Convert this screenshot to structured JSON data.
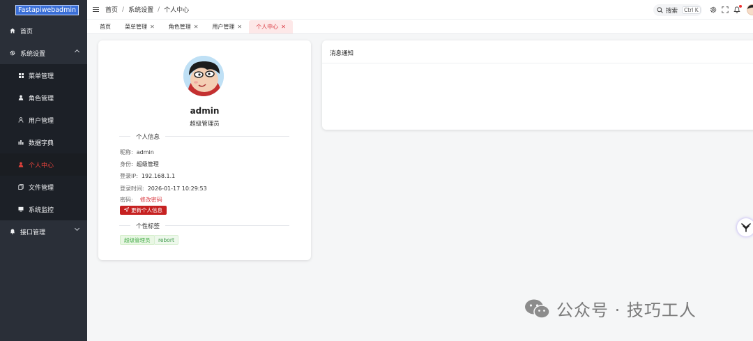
{
  "app": {
    "logo_text": "Fastapiwebadmin"
  },
  "sidebar": {
    "items": [
      {
        "label": "首页",
        "icon": "home-icon"
      },
      {
        "label": "系统设置",
        "icon": "gear-icon",
        "expanded": true
      },
      {
        "label": "菜单管理",
        "icon": "grid-icon"
      },
      {
        "label": "角色管理",
        "icon": "user-icon"
      },
      {
        "label": "用户管理",
        "icon": "user-outline-icon"
      },
      {
        "label": "数据字典",
        "icon": "chart-icon"
      },
      {
        "label": "个人中心",
        "icon": "person-icon",
        "active": true
      },
      {
        "label": "文件管理",
        "icon": "file-icon"
      },
      {
        "label": "系统监控",
        "icon": "monitor-icon"
      },
      {
        "label": "接口管理",
        "icon": "bell-icon"
      }
    ]
  },
  "header": {
    "breadcrumb": [
      "首页",
      "系统设置",
      "个人中心"
    ],
    "breadcrumb_sep": "/",
    "search_label": "搜索",
    "search_shortcut": "Ctrl K"
  },
  "tabs": [
    {
      "label": "首页",
      "closable": false
    },
    {
      "label": "菜单管理",
      "closable": true
    },
    {
      "label": "角色管理",
      "closable": true
    },
    {
      "label": "用户管理",
      "closable": true
    },
    {
      "label": "个人中心",
      "closable": true,
      "active": true
    }
  ],
  "profile": {
    "name": "admin",
    "role": "超级管理员",
    "info_title": "个人信息",
    "info": {
      "nickname_label": "昵称:",
      "nickname": "admin",
      "identity_label": "身份:",
      "identity": "超级管理",
      "ip_label": "登录IP:",
      "ip": "192.168.1.1",
      "time_label": "登录时间:",
      "time": "2026-01-17 10:29:53",
      "password_label": "密码:",
      "password_link": "修改密码"
    },
    "update_button": "更新个人信息",
    "tags_title": "个性标签",
    "tags": [
      "超级管理员",
      "rebort"
    ]
  },
  "notice": {
    "title": "消息通知"
  },
  "watermark": {
    "text": "公众号 · 技巧工人"
  },
  "colors": {
    "accent": "#d9363e",
    "sidebar_bg": "#2a2f38",
    "button_bg": "#c62121"
  }
}
